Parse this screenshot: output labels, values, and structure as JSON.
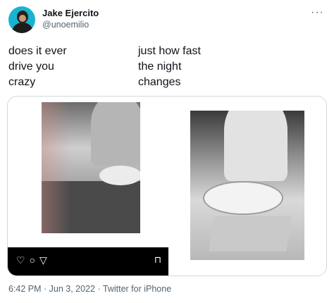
{
  "author": {
    "name": "Jake Ejercito",
    "handle": "@unoemilio"
  },
  "menu": {
    "icon": "more-horizontal-icon",
    "glyph": "···"
  },
  "tweet": {
    "left_text": "does it ever\ndrive you\ncrazy",
    "right_text": "just how fast\nthe night\nchanges"
  },
  "media": {
    "left_photo_icons": [
      "heart-icon",
      "comment-icon",
      "share-icon",
      "bookmark-icon"
    ]
  },
  "footer": {
    "meta": "6:42 PM · Jun 3, 2022 · Twitter for iPhone"
  },
  "colors": {
    "secondary_text": "#536471",
    "border": "#cfd9de",
    "avatar_bg": "#18b4cf"
  }
}
